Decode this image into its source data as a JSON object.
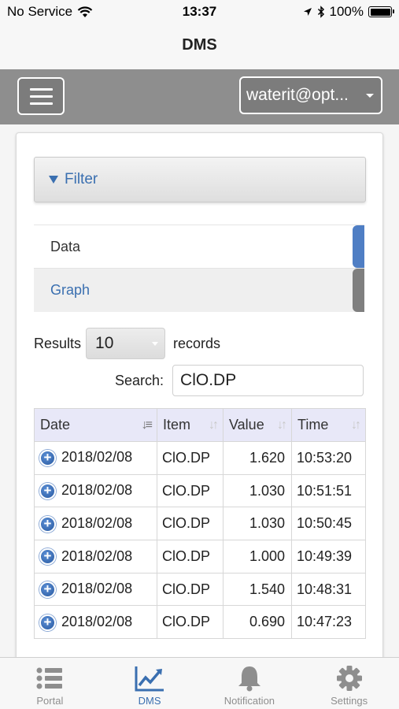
{
  "statusbar": {
    "carrier": "No Service",
    "time": "13:37",
    "battery": "100%"
  },
  "nav": {
    "title": "DMS"
  },
  "header": {
    "account": "waterit@opt..."
  },
  "filter": {
    "label": "Filter"
  },
  "tabs": [
    {
      "label": "Data"
    },
    {
      "label": "Graph"
    }
  ],
  "results": {
    "prefix": "Results",
    "count": "10",
    "suffix": "records"
  },
  "search": {
    "label": "Search:",
    "value": "ClO.DP"
  },
  "table": {
    "headers": [
      "Date",
      "Item",
      "Value",
      "Time"
    ],
    "rows": [
      {
        "date": "2018/02/08",
        "item": "ClO.DP",
        "value": "1.620",
        "time": "10:53:20"
      },
      {
        "date": "2018/02/08",
        "item": "ClO.DP",
        "value": "1.030",
        "time": "10:51:51"
      },
      {
        "date": "2018/02/08",
        "item": "ClO.DP",
        "value": "1.030",
        "time": "10:50:45"
      },
      {
        "date": "2018/02/08",
        "item": "ClO.DP",
        "value": "1.000",
        "time": "10:49:39"
      },
      {
        "date": "2018/02/08",
        "item": "ClO.DP",
        "value": "1.540",
        "time": "10:48:31"
      },
      {
        "date": "2018/02/08",
        "item": "ClO.DP",
        "value": "0.690",
        "time": "10:47:23"
      }
    ]
  },
  "tabbar": [
    {
      "label": "Portal",
      "icon": "list-icon"
    },
    {
      "label": "DMS",
      "icon": "line-chart-icon"
    },
    {
      "label": "Notification",
      "icon": "bell-icon"
    },
    {
      "label": "Settings",
      "icon": "gear-icon"
    }
  ],
  "colors": {
    "accent": "#3a6fb0",
    "header": "#8e8e8e"
  }
}
